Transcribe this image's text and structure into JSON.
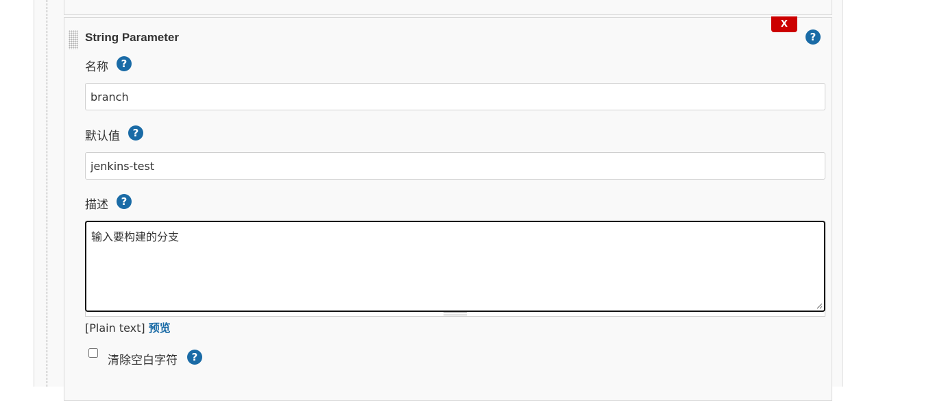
{
  "block": {
    "title": "String Parameter",
    "delete_label": "X",
    "help_glyph": "?"
  },
  "fields": {
    "name": {
      "label": "名称",
      "value": "branch"
    },
    "default_value": {
      "label": "默认值",
      "value": "jenkins-test"
    },
    "description": {
      "label": "描述",
      "value": "输入要构建的分支"
    }
  },
  "preview": {
    "mode": "[Plain text]",
    "link": "预览"
  },
  "trim": {
    "label": "清除空白字符",
    "checked": false
  },
  "colors": {
    "help": "#1a6ba6",
    "delete": "#cc0000",
    "link": "#1a6ba6"
  }
}
